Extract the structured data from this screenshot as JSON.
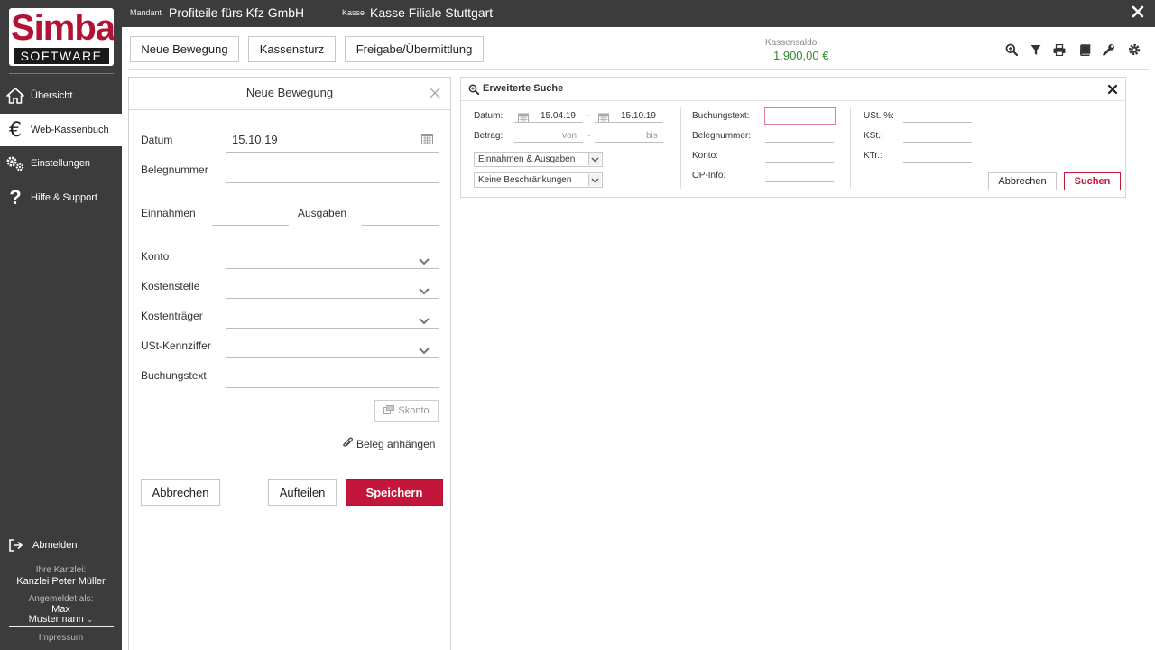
{
  "brand": {
    "logo_top": "Simba",
    "logo_bottom": "SOFTWARE"
  },
  "sidebar": {
    "items": [
      {
        "label": "Übersicht",
        "icon": "home-icon",
        "active": false
      },
      {
        "label": "Web-Kassenbuch",
        "icon": "euro-icon",
        "active": true
      },
      {
        "label": "Einstellungen",
        "icon": "gears-icon",
        "active": false
      },
      {
        "label": "Hilfe & Support",
        "icon": "question-icon",
        "active": false
      }
    ],
    "logout_label": "Abmelden",
    "kanzlei_label": "Ihre Kanzlei:",
    "kanzlei_value": "Kanzlei Peter Müller",
    "user_label": "Angemeldet als:",
    "user_first": "Max",
    "user_last": "Mustermann",
    "impressum": "Impressum"
  },
  "topbar": {
    "mandant_label": "Mandant",
    "mandant_value": "Profiteile fürs Kfz GmbH",
    "kasse_label": "Kasse",
    "kasse_value": "Kasse Filiale Stuttgart"
  },
  "toolbar": {
    "new_label": "Neue Bewegung",
    "kassensturz_label": "Kassensturz",
    "freigabe_label": "Freigabe/Übermittlung",
    "saldo_label": "Kassensaldo",
    "saldo_value": "1.900,00 €",
    "icons": [
      "zoom-icon",
      "filter-icon",
      "print-icon",
      "book-icon",
      "wrench-icon",
      "gear-icon"
    ]
  },
  "form": {
    "title": "Neue Bewegung",
    "datum_label": "Datum",
    "datum_value": "15.10.19",
    "belegnummer_label": "Belegnummer",
    "einnahmen_label": "Einnahmen",
    "ausgaben_label": "Ausgaben",
    "konto_label": "Konto",
    "kostenstelle_label": "Kostenstelle",
    "kostentraeger_label": "Kostenträger",
    "ust_label": "USt-Kennziffer",
    "buchungstext_label": "Buchungstext",
    "skonto_label": "Skonto",
    "beleg_label": "Beleg anhängen",
    "cancel_label": "Abbrechen",
    "split_label": "Aufteilen",
    "save_label": "Speichern"
  },
  "search": {
    "title": "Erweiterte Suche",
    "datum_label": "Datum:",
    "datum_from": "15.04.19",
    "datum_to": "15.10.19",
    "betrag_label": "Betrag:",
    "betrag_from_ph": "von",
    "betrag_to_ph": "bis",
    "dash": "-",
    "type_select": "Einnahmen & Ausgaben",
    "restrict_select": "Keine Beschränkungen",
    "buchungstext_label": "Buchungstext:",
    "belegnummer_label": "Belegnummer:",
    "konto_label": "Konto:",
    "opinfo_label": "OP-Info:",
    "ust_label": "USt. %:",
    "kst_label": "KSt.:",
    "ktr_label": "KTr.:",
    "cancel_label": "Abbrechen",
    "search_label": "Suchen"
  },
  "colors": {
    "brand": "#b31232",
    "accent": "#c4153a",
    "saldo": "#2f8a2f",
    "sidebar": "#3c3c3c"
  }
}
